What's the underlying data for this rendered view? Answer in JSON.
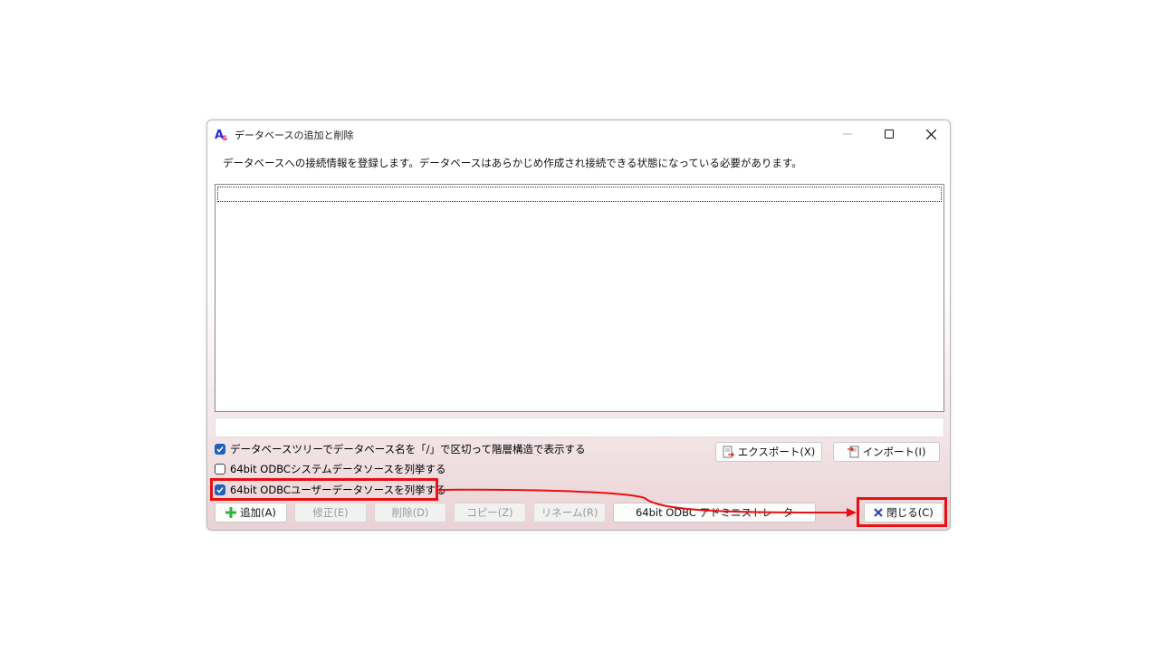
{
  "window": {
    "title": "データベースの追加と削除",
    "description": "データベースへの接続情報を登録します。データベースはあらかじめ作成され接続できる状態になっている必要があります。"
  },
  "controls": {
    "minimize_icon": "minimize-icon",
    "maximize_icon": "maximize-icon",
    "close_icon": "close-icon"
  },
  "checkboxes": [
    {
      "label": "データベースツリーでデータベース名を「/」で区切って階層構造で表示する",
      "checked": true
    },
    {
      "label": "64bit ODBCシステムデータソースを列挙する",
      "checked": false
    },
    {
      "label": "64bit ODBCユーザーデータソースを列挙する",
      "checked": true
    }
  ],
  "buttons": {
    "export": "エクスポート(X)",
    "import": "インポート(I)",
    "add": "追加(A)",
    "modify": "修正(E)",
    "delete": "削除(D)",
    "copy": "コピー(Z)",
    "rename": "リネーム(R)",
    "odbc_admin": "64bit ODBC アドミニストレータ",
    "close": "閉じる(C)"
  },
  "colors": {
    "highlight": "#e81010",
    "checkbox": "#1f5fbf"
  }
}
